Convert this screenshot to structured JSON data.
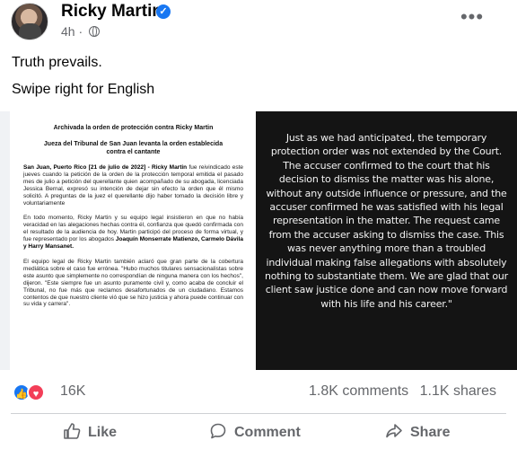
{
  "post": {
    "author": "Ricky Martin",
    "verified_badge": "verified-icon",
    "time": "4h",
    "separator": "·",
    "more_label": "•••",
    "text_line1": "Truth prevails.",
    "text_line2": "Swipe right for English"
  },
  "doc": {
    "title": "Archivada la orden de protección contra Ricky Martin",
    "subtitle": "Jueza del Tribunal de San Juan levanta la orden establecida contra el cantante",
    "p1_lead": "San Juan, Puerto Rico [21 de julio de 2022] - Ricky Martin",
    "p1_rest": "fue reivindicado este jueves cuando la petición de la orden de la protección temporal emitida el pasado mes de julio a petición del querellante quien acompañado de su abogada, licenciada Jessica Bernal, expresó su intención de dejar sin efecto la orden que él mismo solicitó. A preguntas de la juez el querellante dijo haber tomado la decisión libre y voluntariamente",
    "p2": "En todo momento, Ricky Martin y su equipo legal insistieron en que no había veracidad en las alegaciones hechas contra él, confianza que quedó confirmada con el resultado de la audiencia de hoy. Martin participó del proceso de forma virtual, y fue representado por los abogados",
    "p2_names": "Joaquín Monserrate Matienzo, Carmelo Dávila y Harry Mansanet.",
    "p3": "El equipo legal de Ricky Martin también aclaró que gran parte de la cobertura mediática sobre el caso fue errónea. \"Hubo muchos titulares sensacionalistas sobre este asunto que simplemente no correspondían de ninguna manera con los hechos\", dijeron. \"Este siempre fue un asunto puramente civil y, como acaba de concluir el Tribunal, no fue más que reclamos desafortunados de un ciudadano. Estamos contentos de que nuestro cliente vió que se hizo justicia y ahora puede continuar con su vida y carrera\"."
  },
  "quote": {
    "text": "Just as we had anticipated, the temporary protection order was not extended by the Court. The accuser confirmed to the court that his decision to dismiss the matter was his alone, without any outside influence or pressure, and the accuser confirmed he was satisfied with his legal representation in the matter. The request came from the accuser asking to dismiss the case. This was never anything more than a troubled individual making false allegations with absolutely nothing to substantiate them. We are glad that our client saw justice done and can now move forward with his life and his career.\""
  },
  "stats": {
    "reactions_count": "16K",
    "comments": "1.8K comments",
    "shares": "1.1K shares",
    "reaction_icons": [
      "like-icon",
      "love-icon"
    ]
  },
  "actions": {
    "like": "Like",
    "comment": "Comment",
    "share": "Share"
  },
  "colors": {
    "brand_blue": "#1877f2",
    "love_red": "#f33e58",
    "secondary_text": "#65676b",
    "quote_bg": "#141414"
  }
}
